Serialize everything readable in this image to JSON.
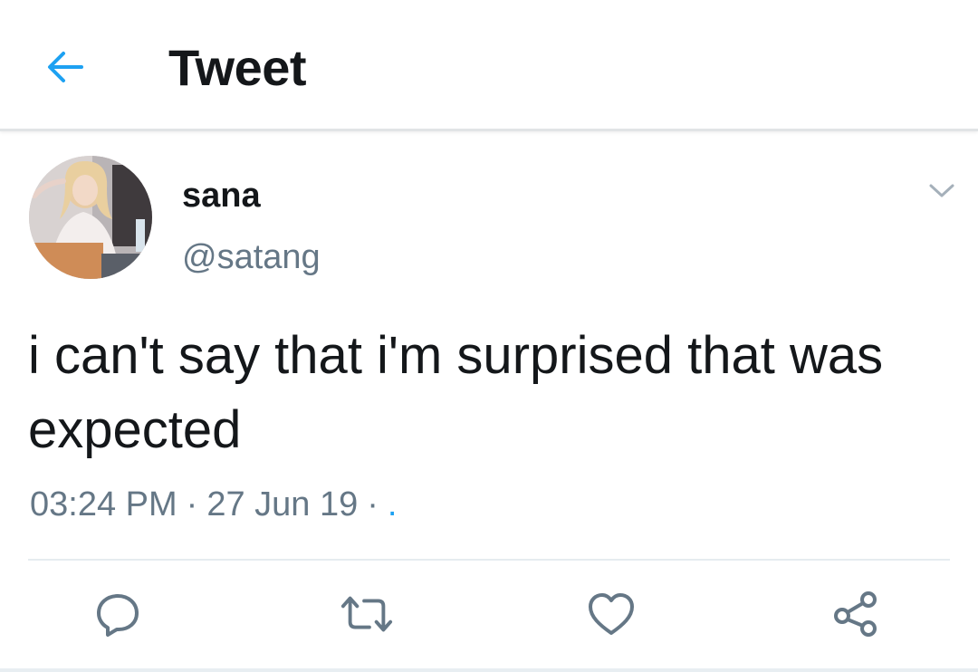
{
  "header": {
    "back_icon": "arrow-left-icon",
    "title": "Tweet"
  },
  "tweet": {
    "author": {
      "display_name": "sana",
      "username": "@satang",
      "avatar_icon": "profile-photo"
    },
    "text": "i can't say that i'm surprised that was expected",
    "time": "03:24 PM",
    "date": "27 Jun 19",
    "separator": "·",
    "source": ".",
    "menu_icon": "chevron-down-icon"
  },
  "actions": [
    {
      "icon": "reply-icon"
    },
    {
      "icon": "retweet-icon"
    },
    {
      "icon": "like-icon"
    },
    {
      "icon": "share-icon"
    }
  ],
  "colors": {
    "accent": "#1da1f2",
    "text": "#14171a",
    "secondary_text": "#657786",
    "icon_gray": "#657786",
    "divider": "#e6ecf0"
  }
}
